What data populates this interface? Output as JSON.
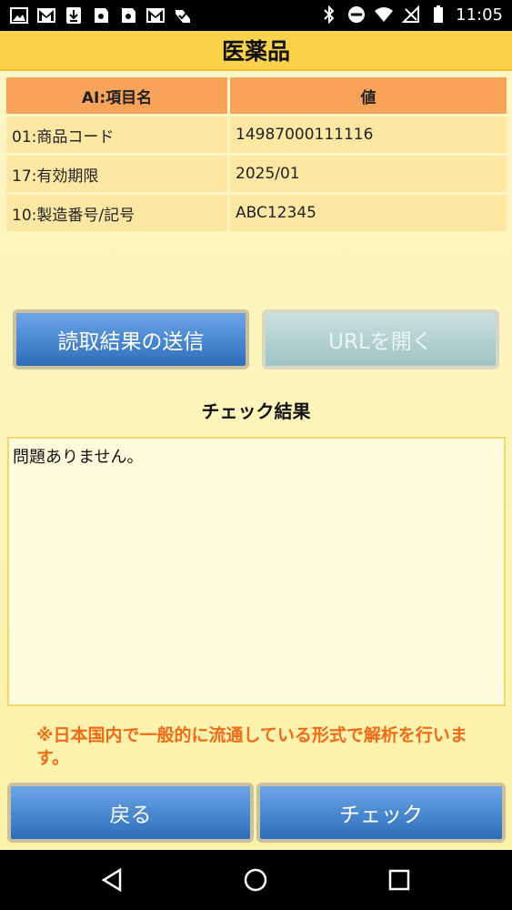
{
  "status_bar": {
    "time": "11:05"
  },
  "title": "医薬品",
  "table": {
    "headers": [
      "AI:項目名",
      "値"
    ],
    "rows": [
      [
        "01:商品コード",
        "14987000111116"
      ],
      [
        "17:有効期限",
        "2025/01"
      ],
      [
        "10:製造番号/記号",
        "ABC12345"
      ]
    ]
  },
  "buttons": {
    "send_result": "読取結果の送信",
    "open_url": "URLを開く",
    "back": "戻る",
    "check": "チェック"
  },
  "check_result": {
    "title": "チェック結果",
    "text": "問題ありません。"
  },
  "notice": "※日本国内で一般的に流通している形式で解析を行います。",
  "colors": {
    "title_bar": "#fbd34a",
    "header_cell": "#f9a35a",
    "body_cell": "#fce7a3",
    "notice_text": "#f06a18",
    "button_blue": "#2e6dba"
  }
}
